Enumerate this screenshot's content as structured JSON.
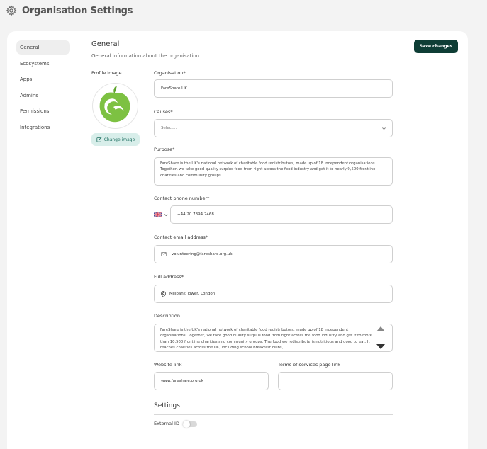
{
  "page": {
    "title": "Organisation Settings",
    "icon": "gear-icon"
  },
  "sidebar": {
    "items": [
      {
        "label": "General",
        "active": true
      },
      {
        "label": "Ecosystems"
      },
      {
        "label": "Apps"
      },
      {
        "label": "Admins"
      },
      {
        "label": "Permissions"
      },
      {
        "label": "Integrations"
      }
    ]
  },
  "section": {
    "title": "General",
    "subtitle": "General information about the organisation"
  },
  "actions": {
    "save_label": "Save changes"
  },
  "profile": {
    "label": "Profile image",
    "change_label": "Change image"
  },
  "form": {
    "organisation": {
      "label": "Organisation*",
      "value": "FareShare UK"
    },
    "causes": {
      "label": "Causes*",
      "placeholder": "Select..."
    },
    "purpose": {
      "label": "Purpose*",
      "value": "FareShare is the UK's national network of charitable food redistributors, made up of 18 independent organisations. Together, we take good quality surplus food from right across the food industry and get it to nearly 9,500 frontline charities and community groups."
    },
    "phone": {
      "label": "Contact phone number*",
      "value": "+44 20 7394 2468",
      "country": "UK"
    },
    "email": {
      "label": "Contact email address*",
      "value": "volunteering@fareshare.org.uk"
    },
    "address": {
      "label": "Full address*",
      "value": "Millbank Tower, London"
    },
    "description": {
      "label": "Description",
      "value": "FareShare is the UK's national network of charitable food redistributors, made up of 18 independent organisations. Together, we take good quality surplus food from right across the food industry and get it to more than 10,500 frontline charities and community groups. The food we redistribute is nutritious and good to eat. It reaches charities across the UK, including school breakfast clubs,"
    },
    "website": {
      "label": "Website link",
      "value": "www.fareshare.org.uk"
    },
    "terms": {
      "label": "Terms of services page link",
      "value": ""
    }
  },
  "settings": {
    "title": "Settings",
    "external_id_label": "External ID",
    "external_id_enabled": false
  },
  "colors": {
    "accent": "#0e3d35",
    "accent_light": "#d8eeea",
    "logo_green": "#7dc142"
  }
}
